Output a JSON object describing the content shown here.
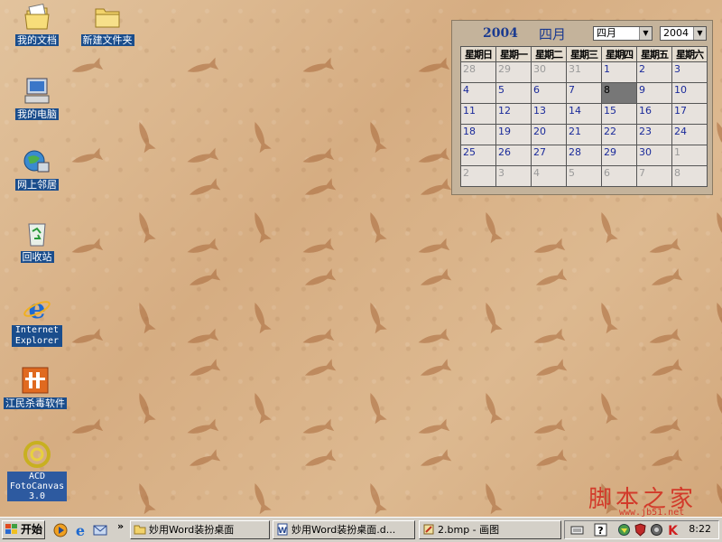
{
  "desktop_icons": [
    {
      "label": "我的文档",
      "icon": "my-documents-icon"
    },
    {
      "label": "新建文件夹",
      "icon": "folder-icon"
    },
    {
      "label": "我的电脑",
      "icon": "my-computer-icon"
    },
    {
      "label": "网上邻居",
      "icon": "network-places-icon"
    },
    {
      "label": "回收站",
      "icon": "recycle-bin-icon"
    },
    {
      "label": "Internet Explorer",
      "icon": "internet-explorer-icon"
    },
    {
      "label": "江民杀毒软件",
      "icon": "antivirus-icon"
    },
    {
      "label": "ACD FotoCanvas 3.0",
      "icon": "acd-fotocanvas-icon"
    }
  ],
  "calendar": {
    "year": "2004",
    "month": "四月",
    "month_select": "四月",
    "year_select": "2004",
    "weekdays": [
      "星期日",
      "星期一",
      "星期二",
      "星期三",
      "星期四",
      "星期五",
      "星期六"
    ],
    "weeks": [
      [
        {
          "d": "28",
          "other": true
        },
        {
          "d": "29",
          "other": true
        },
        {
          "d": "30",
          "other": true
        },
        {
          "d": "31",
          "other": true
        },
        {
          "d": "1"
        },
        {
          "d": "2"
        },
        {
          "d": "3"
        }
      ],
      [
        {
          "d": "4"
        },
        {
          "d": "5"
        },
        {
          "d": "6"
        },
        {
          "d": "7"
        },
        {
          "d": "8",
          "today": true
        },
        {
          "d": "9"
        },
        {
          "d": "10"
        }
      ],
      [
        {
          "d": "11"
        },
        {
          "d": "12"
        },
        {
          "d": "13"
        },
        {
          "d": "14"
        },
        {
          "d": "15"
        },
        {
          "d": "16"
        },
        {
          "d": "17"
        }
      ],
      [
        {
          "d": "18"
        },
        {
          "d": "19"
        },
        {
          "d": "20"
        },
        {
          "d": "21"
        },
        {
          "d": "22"
        },
        {
          "d": "23"
        },
        {
          "d": "24"
        }
      ],
      [
        {
          "d": "25"
        },
        {
          "d": "26"
        },
        {
          "d": "27"
        },
        {
          "d": "28"
        },
        {
          "d": "29"
        },
        {
          "d": "30"
        },
        {
          "d": "1",
          "other": true
        }
      ],
      [
        {
          "d": "2",
          "other": true
        },
        {
          "d": "3",
          "other": true
        },
        {
          "d": "4",
          "other": true
        },
        {
          "d": "5",
          "other": true
        },
        {
          "d": "6",
          "other": true
        },
        {
          "d": "7",
          "other": true
        },
        {
          "d": "8",
          "other": true
        }
      ]
    ]
  },
  "watermark": {
    "text": "脚本之家",
    "url": "www.jb51.net"
  },
  "taskbar": {
    "start_label": "开始",
    "quick_launch": [
      "media-player-icon",
      "internet-explorer-icon",
      "outlook-express-icon"
    ],
    "chevron": "»",
    "tasks": [
      {
        "label": "妙用Word装扮桌面",
        "icon": "folder-icon"
      },
      {
        "label": "妙用Word装扮桌面.d...",
        "icon": "word-document-icon"
      },
      {
        "label": "2.bmp - 画图",
        "icon": "paint-icon"
      }
    ],
    "tray_icons": [
      "keyboard-icon",
      "help-icon",
      "network-tray-icon",
      "shield-tray-icon",
      "kv-antivirus-icon"
    ],
    "clock": "8:22"
  },
  "colors": {
    "wallpaper": "#dcb78f",
    "calendar_bg": "#c4b39b",
    "today_cell": "#777777",
    "calendar_text": "#1a2a9a",
    "watermark": "#d23a2a"
  }
}
